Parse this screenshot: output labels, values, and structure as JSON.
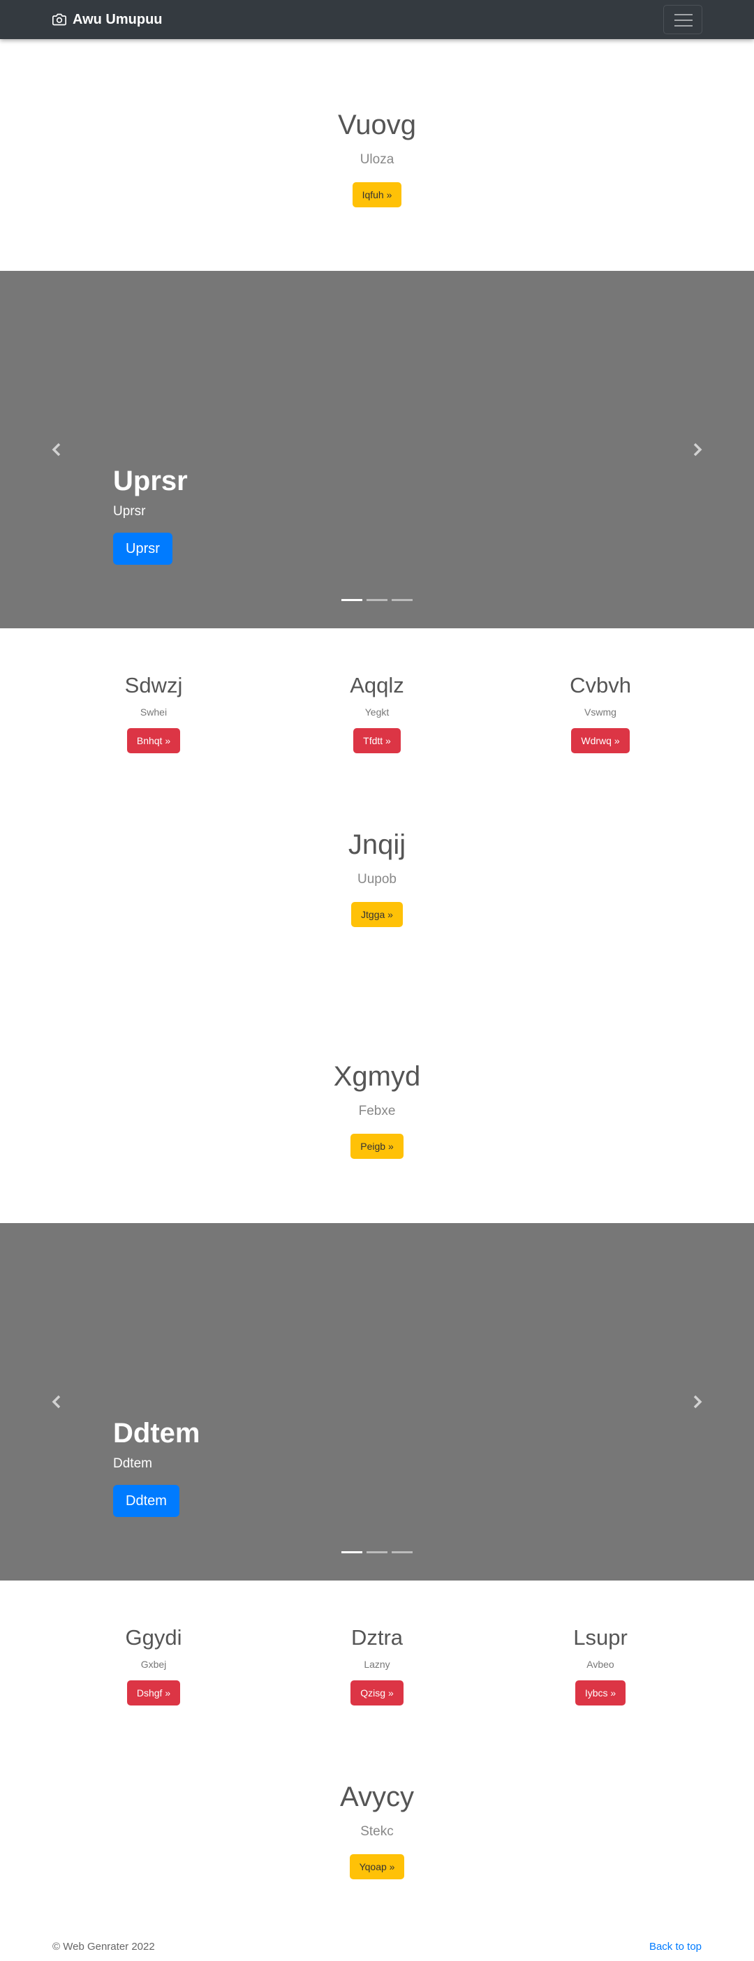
{
  "navbar": {
    "brand": "Awu Umupuu",
    "brand_icon": "camera-icon",
    "toggler_icon": "menu-icon"
  },
  "sections": {
    "hero1": {
      "title": "Vuovg",
      "lead": "Uloza",
      "button": "Iqfuh »"
    },
    "carousel1": {
      "title": "Uprsr",
      "text": "Uprsr",
      "button": "Uprsr",
      "slides": 3,
      "active_slide": 1
    },
    "cols1": [
      {
        "title": "Sdwzj",
        "text": "Swhei",
        "button": "Bnhqt »"
      },
      {
        "title": "Aqqlz",
        "text": "Yegkt",
        "button": "Tfdtt »"
      },
      {
        "title": "Cvbvh",
        "text": "Vswmg",
        "button": "Wdrwq »"
      }
    ],
    "hero2": {
      "title": "Jnqij",
      "lead": "Uupob",
      "button": "Jtgga »"
    },
    "hero3": {
      "title": "Xgmyd",
      "lead": "Febxe",
      "button": "Peigb »"
    },
    "carousel2": {
      "title": "Ddtem",
      "text": "Ddtem",
      "button": "Ddtem",
      "slides": 3,
      "active_slide": 1
    },
    "cols2": [
      {
        "title": "Ggydi",
        "text": "Gxbej",
        "button": "Dshgf »"
      },
      {
        "title": "Dztra",
        "text": "Lazny",
        "button": "Qzisg »"
      },
      {
        "title": "Lsupr",
        "text": "Avbeo",
        "button": "Iybcs »"
      }
    ],
    "hero4": {
      "title": "Avycy",
      "lead": "Stekc",
      "button": "Yqoap »"
    }
  },
  "footer": {
    "copyright": "© Web Genrater 2022",
    "back_to_top": "Back to top"
  },
  "colors": {
    "navbar": "#343a40",
    "carousel_bg": "#777777",
    "warning": "#ffc107",
    "danger": "#dc3545",
    "primary": "#007bff"
  }
}
